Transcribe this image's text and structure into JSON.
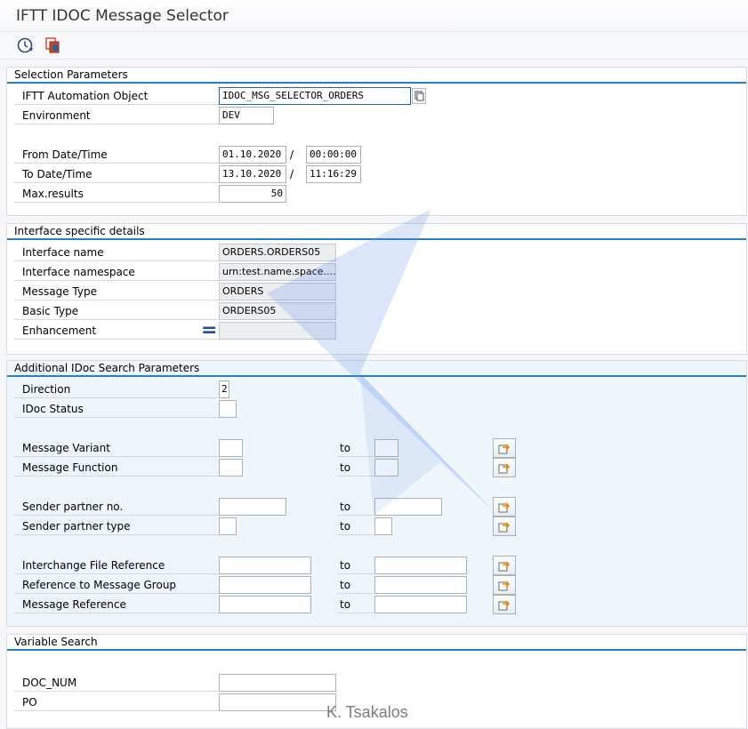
{
  "app": {
    "title": "IFTT IDOC Message Selector"
  },
  "toolbar": {
    "execute_icon": "execute-clock-icon",
    "variant_icon": "copy-variant-icon"
  },
  "selection": {
    "title": "Selection Parameters",
    "automation_object": {
      "label": "IFTT Automation Object",
      "value": "IDOC_MSG_SELECTOR_ORDERS"
    },
    "environment": {
      "label": "Environment",
      "value": "DEV"
    },
    "from": {
      "label": "From Date/Time",
      "date": "01.10.2020",
      "time": "00:00:00"
    },
    "to": {
      "label": "To Date/Time",
      "date": "13.10.2020",
      "time": "11:16:29"
    },
    "date_time_separator": "/",
    "max_results": {
      "label": "Max.results",
      "value": "50"
    }
  },
  "interface": {
    "title": "Interface specific details",
    "name": {
      "label": "Interface name",
      "value": "ORDERS.ORDERS05"
    },
    "namespace": {
      "label": "Interface namespace",
      "value": "urn:test.name.space...."
    },
    "message_type": {
      "label": "Message Type",
      "value": "ORDERS"
    },
    "basic_type": {
      "label": "Basic Type",
      "value": "ORDERS05"
    },
    "enhancement": {
      "label": "Enhancement",
      "value": ""
    }
  },
  "idoc": {
    "title": "Additional IDoc Search Parameters",
    "direction": {
      "label": "Direction",
      "value": "2"
    },
    "status": {
      "label": "IDoc Status",
      "value": ""
    },
    "to_label": "to",
    "message_variant": {
      "label": "Message Variant"
    },
    "message_function": {
      "label": "Message Function"
    },
    "sender_partner_no": {
      "label": "Sender partner no."
    },
    "sender_partner_type": {
      "label": "Sender partner type"
    },
    "interchange_file_ref": {
      "label": "Interchange File Reference"
    },
    "ref_message_group": {
      "label": "Reference to Message Group"
    },
    "message_reference": {
      "label": "Message Reference"
    }
  },
  "variable": {
    "title": "Variable Search",
    "doc_num": {
      "label": "DOC_NUM",
      "value": ""
    },
    "po": {
      "label": "PO",
      "value": ""
    }
  },
  "watermark": "K. Tsakalos",
  "colors": {
    "section_rule": "#2a7fc0",
    "focus_border": "#1c62c7",
    "watermark_fill": "#5b8fe6"
  }
}
